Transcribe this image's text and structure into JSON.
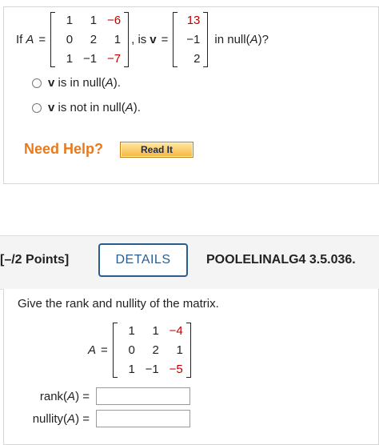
{
  "q1": {
    "if_label": "If",
    "A": "A",
    "eq": "=",
    "matrix": [
      [
        "1",
        "1",
        "−6"
      ],
      [
        "0",
        "2",
        "1"
      ],
      [
        "1",
        "−1",
        "−7"
      ]
    ],
    "is_text": ", is",
    "v": "v",
    "vector": [
      "13",
      "−1",
      "2"
    ],
    "in_null_text": "in null(",
    "in_null_close": ")?",
    "options": [
      {
        "v": "v",
        "text": " is in null(",
        "A": "A",
        "close": ")."
      },
      {
        "v": "v",
        "text": " is not in null(",
        "A": "A",
        "close": ")."
      }
    ],
    "need_help": "Need Help?",
    "read_it": "Read It"
  },
  "q2": {
    "points": "[–/2 Points]",
    "details": "DETAILS",
    "code": "POOLELINALG4 3.5.036.",
    "prompt": "Give the rank and nullity of the matrix.",
    "A": "A",
    "eq": "=",
    "matrix": [
      [
        "1",
        "1",
        "−4"
      ],
      [
        "0",
        "2",
        "1"
      ],
      [
        "1",
        "−1",
        "−5"
      ]
    ],
    "rank_label": "rank(",
    "nullity_label": "nullity(",
    "close_eq": ") =",
    "rank_value": "",
    "nullity_value": ""
  },
  "colors": {
    "red": "#c00000",
    "help": "#e87a1e",
    "details": "#2a5d8c"
  }
}
